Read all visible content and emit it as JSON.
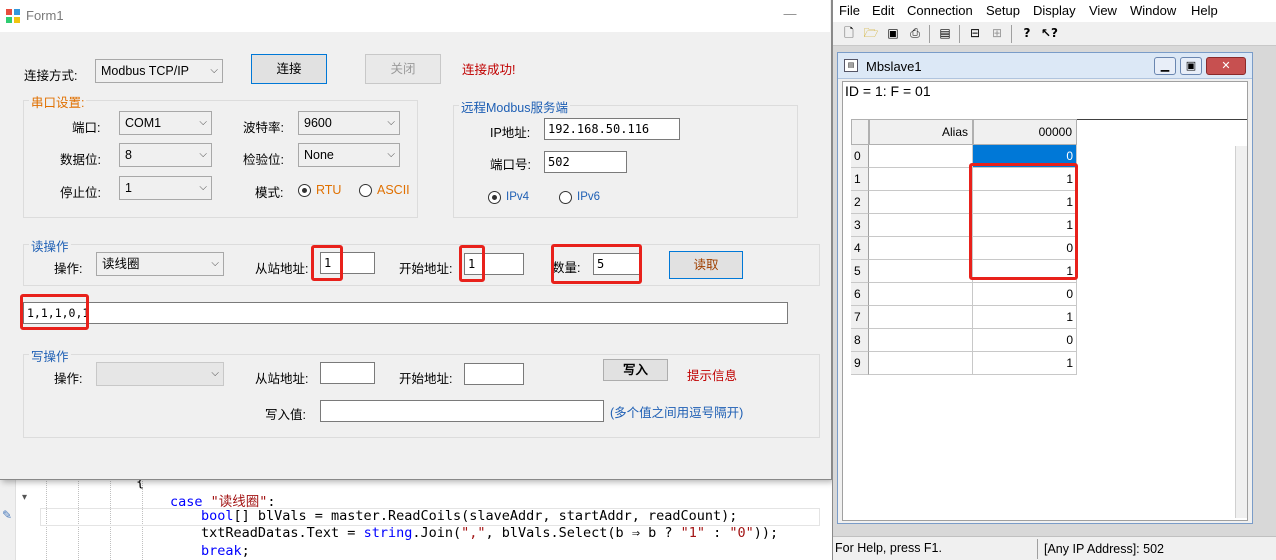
{
  "form1": {
    "title": "Form1",
    "minimize_glyph": "—",
    "connect_mode_label": "连接方式:",
    "connect_mode_value": "Modbus TCP/IP",
    "connect_button": "连接",
    "close_button": "关闭",
    "connect_status": "连接成功!",
    "serial": {
      "group_title": "串口设置:",
      "port_label": "端口:",
      "port_value": "COM1",
      "baud_label": "波特率:",
      "baud_value": "9600",
      "databits_label": "数据位:",
      "databits_value": "8",
      "parity_label": "检验位:",
      "parity_value": "None",
      "stopbits_label": "停止位:",
      "stopbits_value": "1",
      "mode_label": "模式:",
      "mode_rtu": "RTU",
      "mode_ascii": "ASCII"
    },
    "remote": {
      "group_title": "远程Modbus服务端",
      "ip_label": "IP地址:",
      "ip_value": "192.168.50.116",
      "port_label": "端口号:",
      "port_value": "502",
      "ipv4": "IPv4",
      "ipv6": "IPv6"
    },
    "read": {
      "group_title": "读操作",
      "op_label": "操作:",
      "op_value": "读线圈",
      "slave_label": "从站地址:",
      "slave_value": "1",
      "start_label": "开始地址:",
      "start_value": "1",
      "count_label": "数量:",
      "count_value": "5",
      "read_button": "读取",
      "result_value": "1,1,1,0,1"
    },
    "write": {
      "group_title": "写操作",
      "op_label": "操作:",
      "op_value": "",
      "slave_label": "从站地址:",
      "slave_value": "",
      "start_label": "开始地址:",
      "start_value": "",
      "write_button": "写入",
      "hint": "提示信息",
      "value_label": "写入值:",
      "value_value": "",
      "value_hint": "(多个值之间用逗号隔开)"
    }
  },
  "code": {
    "line1": "{",
    "line2_kw": "case",
    "line2_str": "\"读线圈\"",
    "line2_rest": ":",
    "line3_kw": "bool",
    "line3_rest": "[] blVals = master.ReadCoils(slaveAddr, startAddr, readCount);",
    "line4_a": "txtReadDatas.Text = ",
    "line4_kw": "string",
    "line4_b": ".Join(",
    "line4_s1": "\",\"",
    "line4_c": ", blVals.Select(b ⇒ b ? ",
    "line4_s2": "\"1\"",
    "line4_d": " : ",
    "line4_s3": "\"0\"",
    "line4_e": "));",
    "line5_kw": "break",
    "line5_rest": ";"
  },
  "mbslave": {
    "menu": [
      "File",
      "Edit",
      "Connection",
      "Setup",
      "Display",
      "View",
      "Window",
      "Help"
    ],
    "child_title": "Mbslave1",
    "id_line": "ID = 1: F = 01",
    "col_alias": "Alias",
    "col_addr": "00000",
    "rows": [
      {
        "idx": "0",
        "value": "0"
      },
      {
        "idx": "1",
        "value": "1"
      },
      {
        "idx": "2",
        "value": "1"
      },
      {
        "idx": "3",
        "value": "1"
      },
      {
        "idx": "4",
        "value": "0"
      },
      {
        "idx": "5",
        "value": "1"
      },
      {
        "idx": "6",
        "value": "0"
      },
      {
        "idx": "7",
        "value": "1"
      },
      {
        "idx": "8",
        "value": "0"
      },
      {
        "idx": "9",
        "value": "1"
      }
    ],
    "status_help": "For Help, press F1.",
    "status_addr": "[Any IP Address]: 502"
  },
  "colors": {
    "highlight_red": "#e8211b",
    "status_red": "#c00000",
    "accent_blue": "#0078d7",
    "group_orange": "#e07000",
    "hint_blue": "#1e5fb4"
  }
}
